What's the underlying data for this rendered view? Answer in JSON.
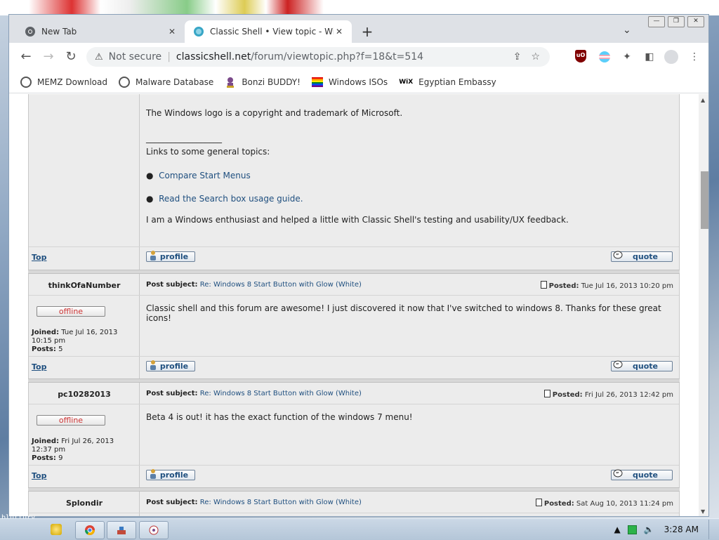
{
  "desktop": {
    "corner_label": "bluttury\n• net/"
  },
  "browser": {
    "tabs": [
      {
        "title": "New Tab",
        "icon": "chrome-icon",
        "active": false
      },
      {
        "title": "Classic Shell • View topic - Windo",
        "icon": "classic-shell-icon",
        "active": true
      }
    ],
    "address": {
      "security": "Not secure",
      "host": "classicshell.net",
      "path": "/forum/viewtopic.php?f=18&t=514"
    },
    "bookmarks": [
      {
        "label": "MEMZ Download",
        "icon": "globe-icon"
      },
      {
        "label": "Malware Database",
        "icon": "globe-icon"
      },
      {
        "label": "Bonzi BUDDY!",
        "icon": "bonzi-icon"
      },
      {
        "label": "Windows ISOs",
        "icon": "rainbow-flag-icon"
      },
      {
        "label": "Egyptian Embassy",
        "icon": "wix-icon",
        "icon_text": "WiX"
      }
    ]
  },
  "signature": {
    "copyright": "The Windows logo is a copyright and trademark of Microsoft.",
    "rule": "__________________",
    "links_heading": "Links to some general topics:",
    "links": [
      "Compare Start Menus",
      "Read the Search box usage guide."
    ],
    "about": "I am a Windows enthusiast and helped a little with Classic Shell's testing and usability/UX feedback."
  },
  "ui": {
    "top_label": "Top",
    "profile_label": "profile",
    "quote_label": "quote",
    "subject_label": "Post subject:",
    "posted_label": "Posted:",
    "joined_label": "Joined:",
    "posts_label": "Posts:",
    "offline_label": "offline"
  },
  "posts": [
    {
      "author": "thinkOfaNumber",
      "subject": "Re: Windows 8 Start Button with Glow (White)",
      "posted": "Tue Jul 16, 2013 10:20 pm",
      "joined_line1": "Tue Jul 16, 2013",
      "joined_line2": "10:15 pm",
      "posts": "5",
      "body": "Classic shell and this forum are awesome! I just discovered it now that I've switched to windows 8. Thanks for these great icons!"
    },
    {
      "author": "pc10282013",
      "subject": "Re: Windows 8 Start Button with Glow (White)",
      "posted": "Fri Jul 26, 2013 12:42 pm",
      "joined_line1": "Fri Jul 26, 2013",
      "joined_line2": "12:37 pm",
      "posts": "9",
      "body": "Beta 4 is out! it has the exact function of the windows 7 menu!"
    },
    {
      "author": "Splondir",
      "subject": "Re: Windows 8 Start Button with Glow (White)",
      "posted": "Sat Aug 10, 2013 11:24 pm"
    }
  ],
  "taskbar": {
    "time": "3:28 AM"
  }
}
